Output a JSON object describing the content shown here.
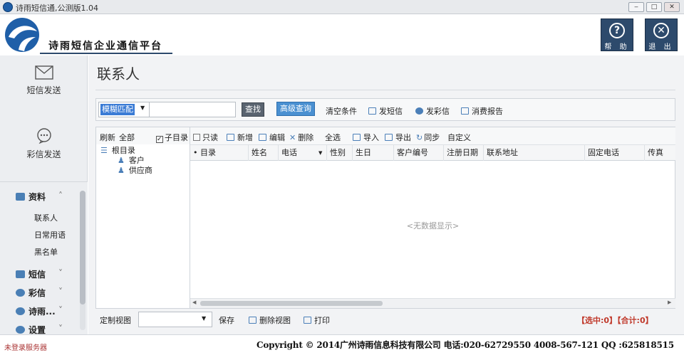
{
  "window": {
    "title": "诗雨短信通,公测版1.04",
    "btn_min": "‒",
    "btn_max": "□",
    "btn_close": "✕"
  },
  "header": {
    "brand": "诗雨短信企业通信平台",
    "help_label": "帮 助",
    "help_glyph": "?",
    "exit_label": "退 出",
    "exit_glyph": "✕"
  },
  "nav": {
    "sms_send": "短信发送",
    "mms_send": "彩信发送"
  },
  "accordion": {
    "data_label": "资料",
    "data_items": [
      "联系人",
      "日常用语",
      "黑名单"
    ],
    "sms_label": "短信",
    "mms_label": "彩信",
    "shiyu_label": "诗雨...",
    "settings_label": "设置"
  },
  "page": {
    "title": "联系人"
  },
  "search": {
    "match_mode": "模糊匹配",
    "keyword": "",
    "find": "查找",
    "advanced": "高级查询",
    "clear": "清空条件",
    "send_sms": "发短信",
    "send_mms": "发彩信",
    "usage_report": "消费报告"
  },
  "tree": {
    "refresh": "刷新",
    "all": "全部",
    "subdir_label": "子目录",
    "subdir_checked": true,
    "root": "根目录",
    "children": [
      "客户",
      "供应商"
    ]
  },
  "grid_toolbar": {
    "readonly": "只读",
    "add": "新增",
    "edit": "编辑",
    "delete": "删除",
    "select_all": "全选",
    "import": "导入",
    "export": "导出",
    "sync": "同步",
    "custom": "自定义"
  },
  "columns": [
    "目录",
    "姓名",
    "电话",
    "性别",
    "生日",
    "客户编号",
    "注册日期",
    "联系地址",
    "固定电话",
    "传真"
  ],
  "empty_text": "<无数据显示>",
  "bottom": {
    "custom_view": "定制视图",
    "view_value": "",
    "save": "保存",
    "delete_view": "删除视图",
    "print": "打印",
    "selection": "【选中:0】【合计:0】"
  },
  "footer": {
    "server_status": "未登录服务器",
    "copyright": "Copyright © 2014广州诗雨信息科技有限公司 电话:020-62729550  4008-567-121  QQ :625818515"
  },
  "colors": {
    "accent": "#2d4a6c",
    "highlight": "#4a90d1",
    "alert": "#c0392b"
  }
}
